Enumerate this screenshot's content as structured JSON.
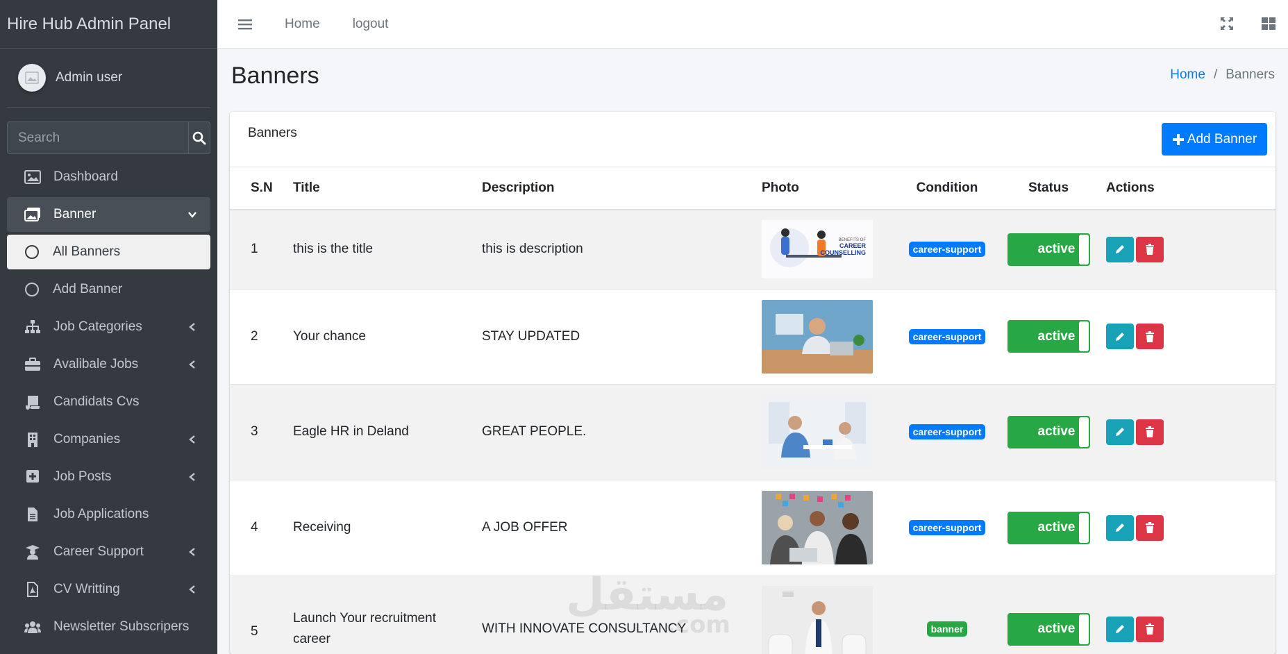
{
  "app": {
    "brand": "Hire Hub Admin Panel"
  },
  "user": {
    "name": "Admin user"
  },
  "search": {
    "placeholder": "Search"
  },
  "sidebar": {
    "items": [
      {
        "label": "Dashboard",
        "icon": "image-icon"
      },
      {
        "label": "Banner",
        "icon": "images-icon",
        "state": "open"
      },
      {
        "label": "All Banners",
        "icon": "circle-icon",
        "state": "active"
      },
      {
        "label": "Add Banner",
        "icon": "circle-icon"
      },
      {
        "label": "Job Categories",
        "icon": "sitemap-icon"
      },
      {
        "label": "Avalibale Jobs",
        "icon": "briefcase-icon"
      },
      {
        "label": "Candidats Cvs",
        "icon": "scroll-icon"
      },
      {
        "label": "Companies",
        "icon": "building-icon"
      },
      {
        "label": "Job Posts",
        "icon": "plus-square-icon"
      },
      {
        "label": "Job Applications",
        "icon": "file-icon"
      },
      {
        "label": "Career Support",
        "icon": "user-graduate-icon"
      },
      {
        "label": "CV Writting",
        "icon": "file-pdf-icon"
      },
      {
        "label": "Newsletter Subscripers",
        "icon": "users-icon"
      }
    ]
  },
  "topbar": {
    "home": "Home",
    "logout": "logout"
  },
  "page": {
    "title": "Banners"
  },
  "breadcrumb": {
    "home": "Home",
    "separator": "/",
    "current": "Banners"
  },
  "card": {
    "title": "Banners",
    "add_button": "Add Banner"
  },
  "table": {
    "headers": [
      "S.N",
      "Title",
      "Description",
      "Photo",
      "Condition",
      "Status",
      "Actions"
    ],
    "rows": [
      {
        "sn": "1",
        "title": "this is the title",
        "description": "this is description",
        "condition": "career-support",
        "status": "active"
      },
      {
        "sn": "2",
        "title": "Your chance",
        "description": "STAY UPDATED",
        "condition": "career-support",
        "status": "active"
      },
      {
        "sn": "3",
        "title": "Eagle HR in Deland",
        "description": "GREAT PEOPLE.",
        "condition": "career-support",
        "status": "active"
      },
      {
        "sn": "4",
        "title": "Receiving",
        "description": "A JOB OFFER",
        "condition": "career-support",
        "status": "active"
      },
      {
        "sn": "5",
        "title": "Launch Your recruitment career",
        "description": "WITH INNOVATE CONSULTANCY",
        "condition": "banner",
        "status": "active"
      }
    ]
  },
  "colors": {
    "sidebar_bg": "#343a40",
    "primary": "#007bff",
    "success": "#28a745",
    "info": "#17a2b8",
    "danger": "#dc3545"
  }
}
